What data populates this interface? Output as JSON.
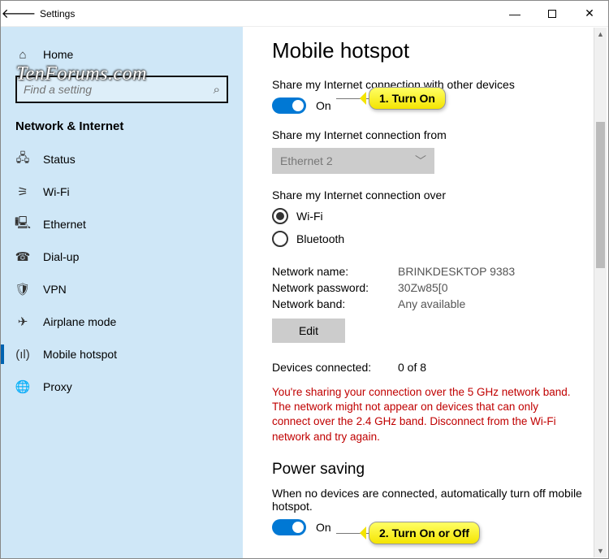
{
  "titlebar": {
    "app": "Settings"
  },
  "sidebar": {
    "home": "Home",
    "search_placeholder": "Find a setting",
    "section": "Network & Internet",
    "items": [
      {
        "label": "Status"
      },
      {
        "label": "Wi-Fi"
      },
      {
        "label": "Ethernet"
      },
      {
        "label": "Dial-up"
      },
      {
        "label": "VPN"
      },
      {
        "label": "Airplane mode"
      },
      {
        "label": "Mobile hotspot"
      },
      {
        "label": "Proxy"
      }
    ]
  },
  "main": {
    "title": "Mobile hotspot",
    "share_label": "Share my Internet connection with other devices",
    "toggle1_state": "On",
    "share_from_label": "Share my Internet connection from",
    "share_from_value": "Ethernet 2",
    "share_over_label": "Share my Internet connection over",
    "radio_wifi": "Wi-Fi",
    "radio_bt": "Bluetooth",
    "net_name_k": "Network name:",
    "net_name_v": "BRINKDESKTOP 9383",
    "net_pass_k": "Network password:",
    "net_pass_v": "30Zw85[0",
    "net_band_k": "Network band:",
    "net_band_v": "Any available",
    "edit": "Edit",
    "devices_k": "Devices connected:",
    "devices_v": "0 of 8",
    "warning": "You're sharing your connection over the 5 GHz network band. The network might not appear on devices that can only connect over the 2.4 GHz band. Disconnect from the Wi-Fi network and try again.",
    "power_heading": "Power saving",
    "power_label": "When no devices are connected, automatically turn off mobile hotspot.",
    "toggle2_state": "On"
  },
  "callouts": {
    "c1": "1. Turn On",
    "c2": "2. Turn On or Off"
  },
  "watermark": "TenForums.com"
}
